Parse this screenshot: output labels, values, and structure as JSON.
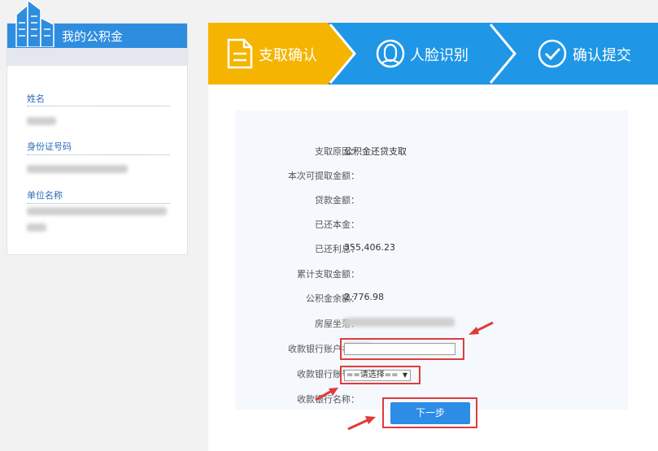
{
  "sidebar": {
    "title": "我的公积金",
    "fields": [
      {
        "label": "姓名"
      },
      {
        "label": "身份证号码"
      },
      {
        "label": "单位名称"
      }
    ]
  },
  "steps": [
    {
      "label": "支取确认",
      "active": true
    },
    {
      "label": "人脸识别",
      "active": false
    },
    {
      "label": "确认提交",
      "active": false
    }
  ],
  "form": {
    "rows": [
      {
        "label": "支取原因：",
        "value": "公积金还贷支取"
      },
      {
        "label": "本次可提取金额：",
        "value": ""
      },
      {
        "label": "贷款金额：",
        "value": ""
      },
      {
        "label": "已还本金：",
        "value": ""
      },
      {
        "label": "已还利息：",
        "value": "355,406.23"
      },
      {
        "label": "累计支取金额：",
        "value": ""
      },
      {
        "label": "公积金余额：",
        "value": "2,776.98"
      },
      {
        "label": "房屋坐落：",
        "value": ""
      },
      {
        "label": "收款银行账户名：",
        "value": ""
      },
      {
        "label": "收款银行账号：",
        "value": ""
      },
      {
        "label": "收款银行名称：",
        "value": ""
      }
    ],
    "bank_select": "==请选择==",
    "next_button": "下一步"
  },
  "colors": {
    "accent_blue": "#2f8de0",
    "step_active": "#f5b400",
    "step_inactive": "#1f97e6",
    "annotation_red": "#e03b3b"
  }
}
